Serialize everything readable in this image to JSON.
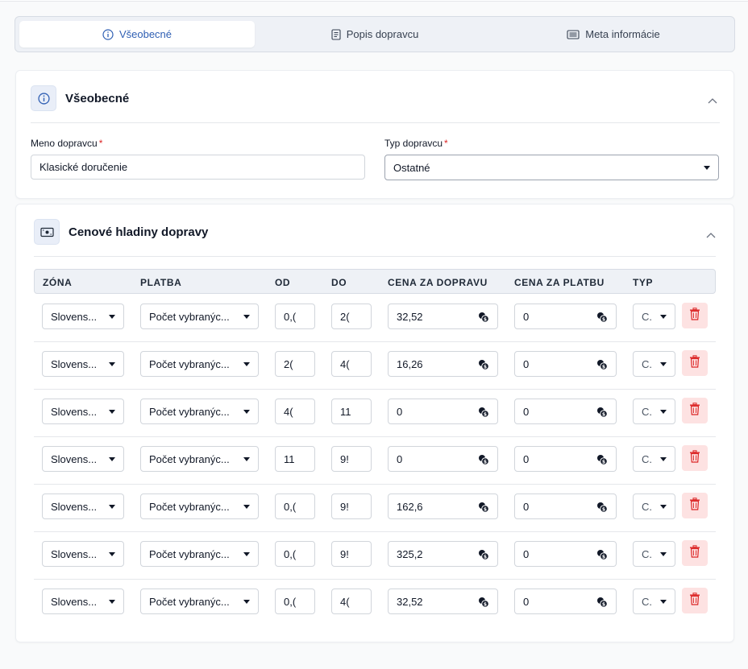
{
  "tabs": [
    {
      "label": "Všeobecné",
      "icon": "info-icon",
      "active": true
    },
    {
      "label": "Popis dopravcu",
      "icon": "document-icon",
      "active": false
    },
    {
      "label": "Meta informácie",
      "icon": "list-icon",
      "active": false
    }
  ],
  "general": {
    "title": "Všeobecné",
    "name_label": "Meno dopravcu",
    "name_value": "Klasické doručenie",
    "type_label": "Typ dopravcu",
    "type_value": "Ostatné",
    "required_mark": "*"
  },
  "pricing": {
    "title": "Cenové hladiny dopravy",
    "columns": [
      "ZÓNA",
      "PLATBA",
      "OD",
      "DO",
      "CENA ZA DOPRAVU",
      "CENA ZA PLATBU",
      "TYP"
    ],
    "rows": [
      {
        "zone": "Slovens...",
        "payment": "Počet vybranýc...",
        "from": "0,(",
        "to": "2(",
        "ship_price": "32,52",
        "pay_price": "0",
        "type": "C."
      },
      {
        "zone": "Slovens...",
        "payment": "Počet vybranýc...",
        "from": "2(",
        "to": "4(",
        "ship_price": "16,26",
        "pay_price": "0",
        "type": "C."
      },
      {
        "zone": "Slovens...",
        "payment": "Počet vybranýc...",
        "from": "4(",
        "to": "11",
        "ship_price": "0",
        "pay_price": "0",
        "type": "C."
      },
      {
        "zone": "Slovens...",
        "payment": "Počet vybranýc...",
        "from": "11",
        "to": "9!",
        "ship_price": "0",
        "pay_price": "0",
        "type": "C."
      },
      {
        "zone": "Slovens...",
        "payment": "Počet vybranýc...",
        "from": "0,(",
        "to": "9!",
        "ship_price": "162,6",
        "pay_price": "0",
        "type": "C."
      },
      {
        "zone": "Slovens...",
        "payment": "Počet vybranýc...",
        "from": "0,(",
        "to": "9!",
        "ship_price": "325,2",
        "pay_price": "0",
        "type": "C."
      },
      {
        "zone": "Slovens...",
        "payment": "Počet vybranýc...",
        "from": "0,(",
        "to": "4(",
        "ship_price": "32,52",
        "pay_price": "0",
        "type": "C."
      }
    ]
  },
  "colors": {
    "accent": "#2f5fb3",
    "danger": "#dc2626",
    "danger_bg": "#fde2e2"
  }
}
